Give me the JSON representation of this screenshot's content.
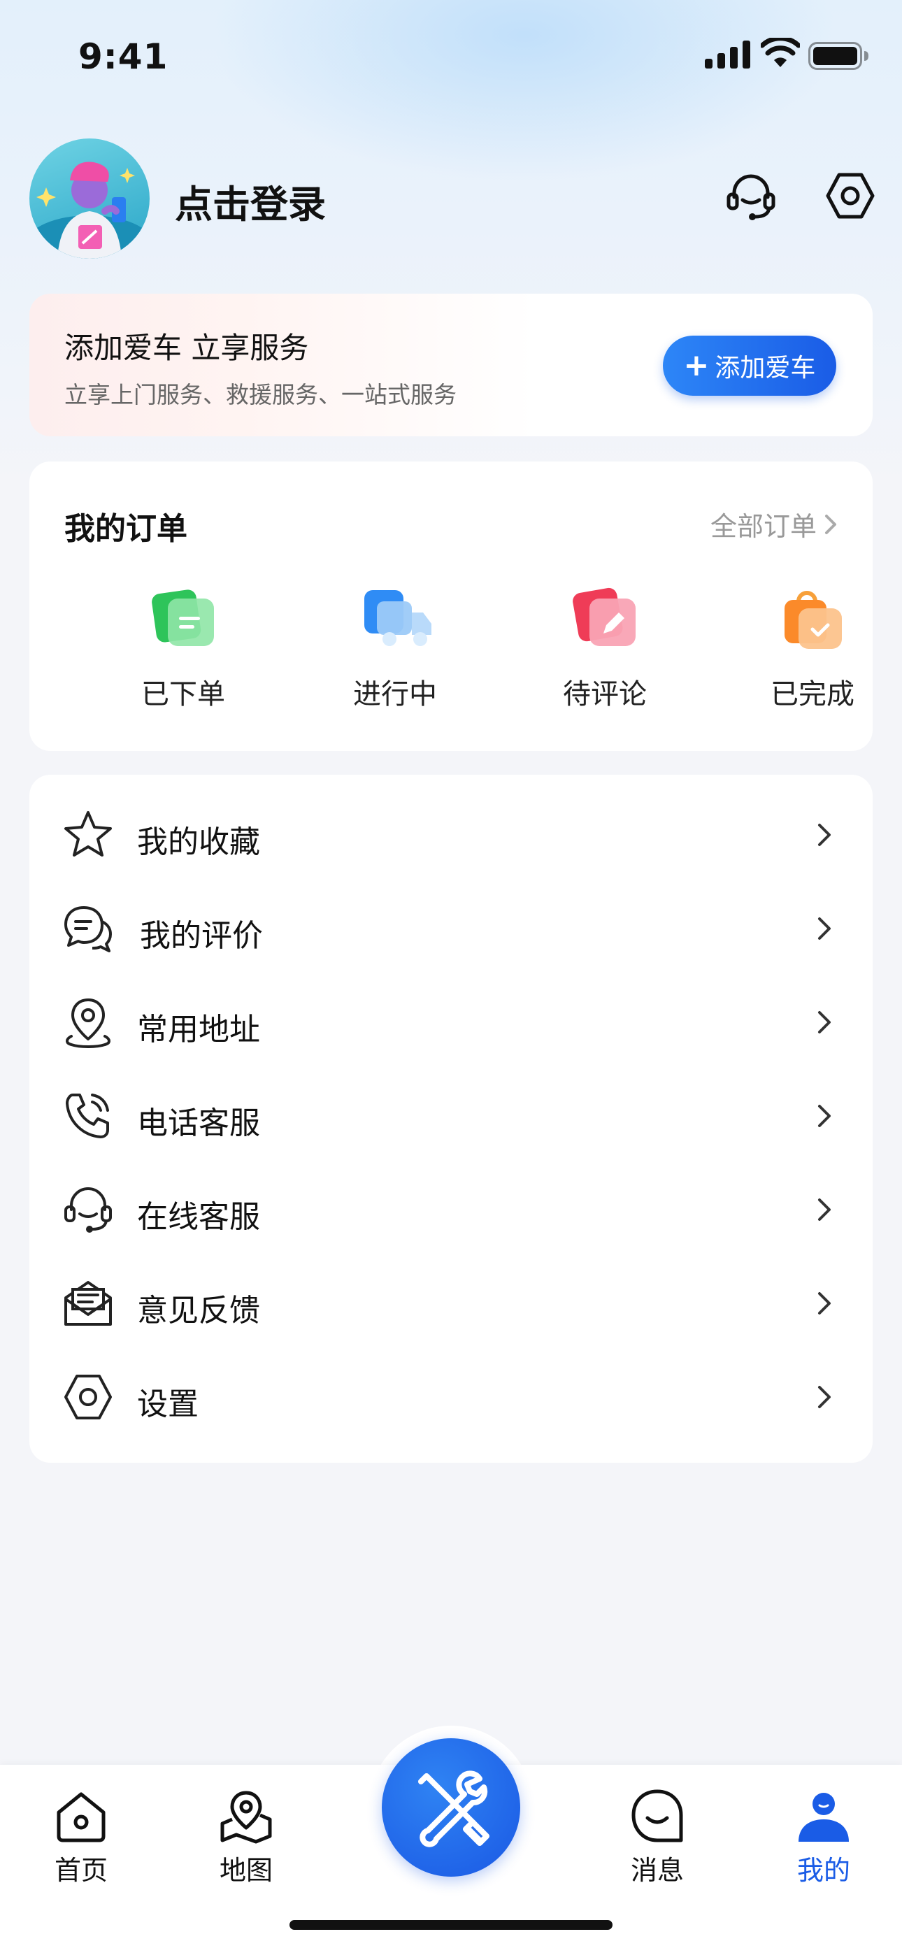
{
  "status_bar": {
    "time": "9:41"
  },
  "header": {
    "login_label": "点击登录"
  },
  "add_car": {
    "title": "添加爱车 立享服务",
    "subtitle": "立享上门服务、救援服务、一站式服务",
    "button_label": "添加爱车"
  },
  "orders": {
    "title": "我的订单",
    "all_label": "全部订单",
    "items": [
      {
        "label": "已下单",
        "icon": "order-placed-icon",
        "color": "#3ccf62"
      },
      {
        "label": "进行中",
        "icon": "truck-icon",
        "color": "#3a8ef6"
      },
      {
        "label": "待评论",
        "icon": "edit-icon",
        "color": "#f2475f"
      },
      {
        "label": "已完成",
        "icon": "shopping-bag-check-icon",
        "color": "#fb8a2a"
      }
    ]
  },
  "menu": {
    "items": [
      {
        "label": "我的收藏",
        "icon": "star-icon"
      },
      {
        "label": "我的评价",
        "icon": "chat-bubbles-icon"
      },
      {
        "label": "常用地址",
        "icon": "location-pin-icon"
      },
      {
        "label": "电话客服",
        "icon": "phone-icon"
      },
      {
        "label": "在线客服",
        "icon": "headset-icon"
      },
      {
        "label": "意见反馈",
        "icon": "mail-feedback-icon"
      },
      {
        "label": "设置",
        "icon": "settings-hexagon-icon"
      }
    ]
  },
  "tabbar": {
    "items": [
      {
        "label": "首页",
        "icon": "home-icon"
      },
      {
        "label": "地图",
        "icon": "map-icon"
      },
      {
        "label": "",
        "icon": "tools-icon"
      },
      {
        "label": "消息",
        "icon": "message-smile-icon"
      },
      {
        "label": "我的",
        "icon": "user-icon"
      }
    ],
    "active": "我的",
    "accent": "#1a5ce6"
  }
}
